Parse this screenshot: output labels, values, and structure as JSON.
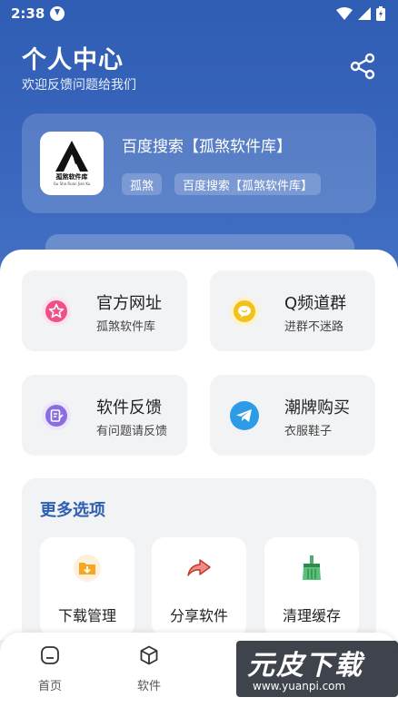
{
  "status_bar": {
    "time": "2:38"
  },
  "header": {
    "title": "个人中心",
    "subtitle": "欢迎反馈问题给我们"
  },
  "app_card": {
    "name": "百度搜索【孤煞软件库】",
    "logo_caption": "孤煞软件库",
    "logo_tiny": "Gu Sha Ruan Jian Ku",
    "tags": [
      "孤煞",
      "百度搜索【孤煞软件库】"
    ]
  },
  "tiles": [
    {
      "title": "官方网址",
      "sub": "孤煞软件库",
      "icon": "star-icon",
      "color": "#f0508a"
    },
    {
      "title": "Q频道群",
      "sub": "进群不迷路",
      "icon": "chat-bubble-icon",
      "color": "#f2c21b"
    },
    {
      "title": "软件反馈",
      "sub": "有问题请反馈",
      "icon": "feedback-icon",
      "color": "#8a6ee0"
    },
    {
      "title": "潮牌购买",
      "sub": "衣服鞋子",
      "icon": "telegram-plane-icon",
      "color": "#2e9be6"
    }
  ],
  "more": {
    "title": "更多选项",
    "options": [
      {
        "label": "下载管理",
        "icon": "download-folder-icon"
      },
      {
        "label": "分享软件",
        "icon": "share-arrow-icon"
      },
      {
        "label": "清理缓存",
        "icon": "broom-icon"
      }
    ]
  },
  "nav": [
    {
      "label": "首页",
      "icon": "home-icon"
    },
    {
      "label": "软件",
      "icon": "cube-icon"
    }
  ],
  "watermark": {
    "big": "元皮下载",
    "small": "www.yuanpi.com"
  },
  "colors": {
    "accent": "#2f5db3",
    "background": "#f2f3f5"
  }
}
